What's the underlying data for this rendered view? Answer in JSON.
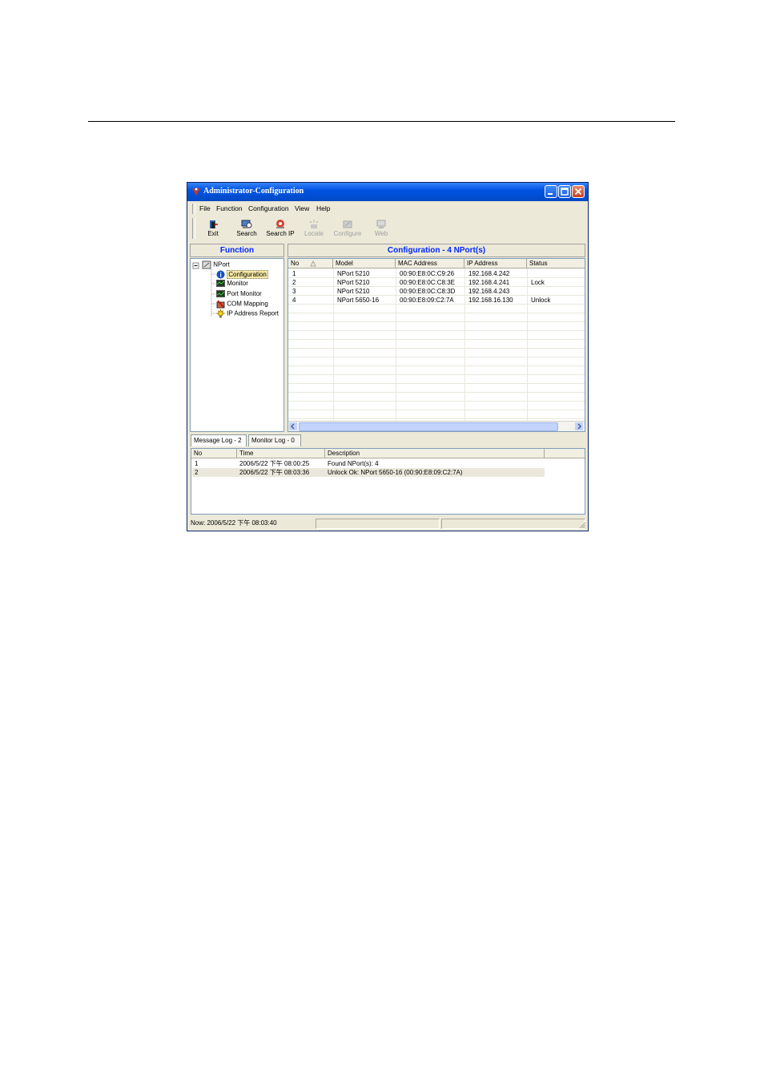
{
  "window": {
    "title": "Administrator-Configuration"
  },
  "menu": [
    "File",
    "Function",
    "Configuration",
    "View",
    "Help"
  ],
  "toolbar": [
    {
      "label": "Exit",
      "icon": "exit-icon",
      "enabled": true
    },
    {
      "label": "Search",
      "icon": "search-icon",
      "enabled": true
    },
    {
      "label": "Search IP",
      "icon": "search-ip-icon",
      "enabled": true
    },
    {
      "label": "Locate",
      "icon": "locate-icon",
      "enabled": false
    },
    {
      "label": "Configure",
      "icon": "configure-icon",
      "enabled": false
    },
    {
      "label": "Web",
      "icon": "web-icon",
      "enabled": false
    }
  ],
  "function_panel": {
    "title": "Function",
    "root": "NPort",
    "items": [
      "Configuration",
      "Monitor",
      "Port Monitor",
      "COM Mapping",
      "IP Address Report"
    ],
    "selected": "Configuration"
  },
  "config_panel": {
    "title": "Configuration - 4 NPort(s)",
    "columns": [
      "No",
      "Model",
      "MAC Address",
      "IP Address",
      "Status"
    ],
    "rows": [
      [
        "1",
        "NPort 5210",
        "00:90:E8:0C:C9:26",
        "192.168.4.242",
        ""
      ],
      [
        "2",
        "NPort 5210",
        "00:90:E8:0C:C8:3E",
        "192.168.4.241",
        "Lock"
      ],
      [
        "3",
        "NPort 5210",
        "00:90:E8:0C:C8:3D",
        "192.168.4.243",
        ""
      ],
      [
        "4",
        "NPort 5650-16",
        "00:90:E8:09:C2:7A",
        "192.168.16.130",
        "Unlock"
      ]
    ]
  },
  "log_tabs": [
    "Message Log - 2",
    "Monitor Log - 0"
  ],
  "message_log": {
    "columns": [
      "No",
      "Time",
      "Description"
    ],
    "rows": [
      [
        "1",
        "2006/5/22 下午 08:00:25",
        "Found NPort(s): 4"
      ],
      [
        "2",
        "2006/5/22 下午 08:03:36",
        "Unlock Ok: NPort 5650-16 (00:90:E8:09:C2:7A)"
      ]
    ]
  },
  "status_bar": {
    "now": "Now: 2006/5/22 下午 08:03:40"
  },
  "colors": {
    "title_bar": "#0054e3",
    "panel_title": "#0026ff",
    "window_bg": "#ece9d8"
  }
}
